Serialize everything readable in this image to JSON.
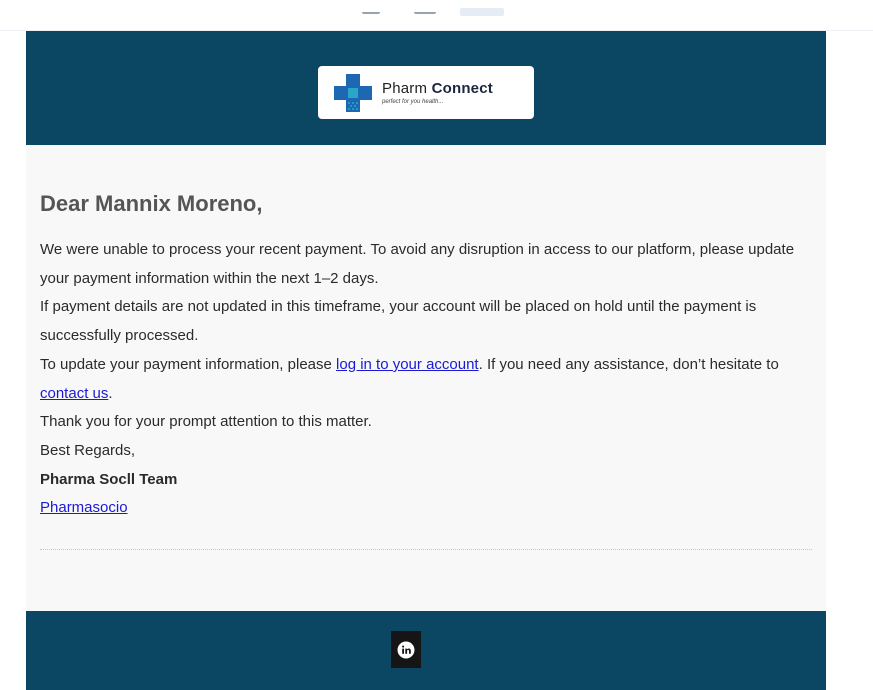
{
  "brand": {
    "name_regular": "Pharm",
    "name_bold": "Connect",
    "tagline": "perfect for you health..."
  },
  "email": {
    "greeting": "Dear Mannix Moreno,",
    "line1": "We were unable to process your recent payment. To avoid any disruption in access to our platform, please update your payment information within the next 1–2 days.",
    "line2": "If payment details are not updated in this timeframe, your account will be placed on hold until the payment is successfully processed.",
    "line3_before": "To update your payment information, please ",
    "line3_link": "log in to your account",
    "line3_after": ". If you need any assistance, don’t hesitate to ",
    "line3_link2": "contact us",
    "line3_end": ".",
    "thanks": "Thank you for your prompt attention to this matter.",
    "closing": "Best Regards,",
    "team": "Pharma Socll Team",
    "signature_link": "Pharmasocio"
  },
  "footer": {
    "social_icon": "linkedin-icon"
  },
  "colors": {
    "header_bg": "#0b4763",
    "link": "#1a1ad6"
  }
}
